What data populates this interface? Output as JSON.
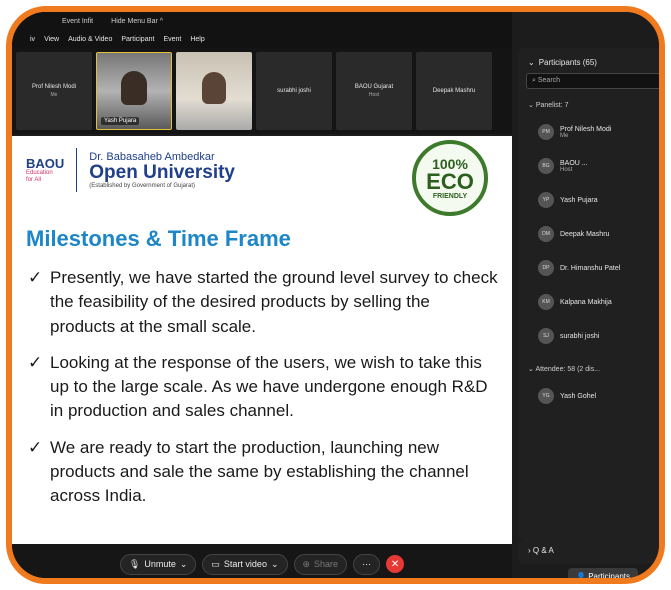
{
  "titlebar": {
    "left": "Event Infit",
    "right": "Hide Menu Bar ^"
  },
  "menu": [
    "iv",
    "View",
    "Audio & Video",
    "Participant",
    "Event",
    "Help"
  ],
  "strip": [
    {
      "name": "Prof Nilesh Modi",
      "sub": "Me",
      "type": "label"
    },
    {
      "name": "Yash Pujara",
      "type": "video"
    },
    {
      "name": "",
      "type": "video2"
    },
    {
      "name": "surabhi joshi",
      "type": "label"
    },
    {
      "name": "BAOU Gujarat",
      "sub": "Host",
      "type": "label"
    },
    {
      "name": "Deepak Mashru",
      "type": "label"
    }
  ],
  "slide": {
    "baou": "BAOU",
    "baou_sub1": "Education",
    "baou_sub2": "for All",
    "uni_line1": "Dr. Babasaheb Ambedkar",
    "uni_line2": "Open University",
    "uni_line3": "(Established by Government of Gujarat)",
    "eco1": "100%",
    "eco2": "ECO",
    "eco3": "FRIENDLY",
    "heading": "Milestones & Time Frame",
    "bullets": [
      "Presently, we have started the ground level survey to check the feasibility of the desired products by selling the products at the small scale.",
      "Looking at the response of the users, we wish to take this up to the large scale. As we have undergone enough R&D in production and sales channel.",
      "We are ready to start the production, launching new products and sale the same by establishing the channel across India."
    ]
  },
  "toolbar": {
    "unmute": "Unmute",
    "video": "Start video",
    "share": "Share"
  },
  "panel": {
    "title": "Participants (65)",
    "search": "Search",
    "panelist": "Panelist: 7",
    "attendee": "Attendee: 58 (2 dis...",
    "people": [
      {
        "initials": "PM",
        "name": "Prof Nilesh Modi",
        "sub": "Me"
      },
      {
        "initials": "BG",
        "name": "BAOU ...",
        "sub": "Host"
      },
      {
        "initials": "YP",
        "name": "Yash Pujara",
        "sub": ""
      },
      {
        "initials": "DM",
        "name": "Deepak Mashru",
        "sub": ""
      },
      {
        "initials": "DP",
        "name": "Dr. Himanshu Patel",
        "sub": ""
      },
      {
        "initials": "KM",
        "name": "Kalpana Makhija",
        "sub": ""
      },
      {
        "initials": "SJ",
        "name": "surabhi joshi",
        "sub": ""
      }
    ],
    "attendee_person": {
      "initials": "YG",
      "name": "Yash Gohel"
    },
    "qa": "Q & A",
    "participants_btn": "Participants"
  }
}
